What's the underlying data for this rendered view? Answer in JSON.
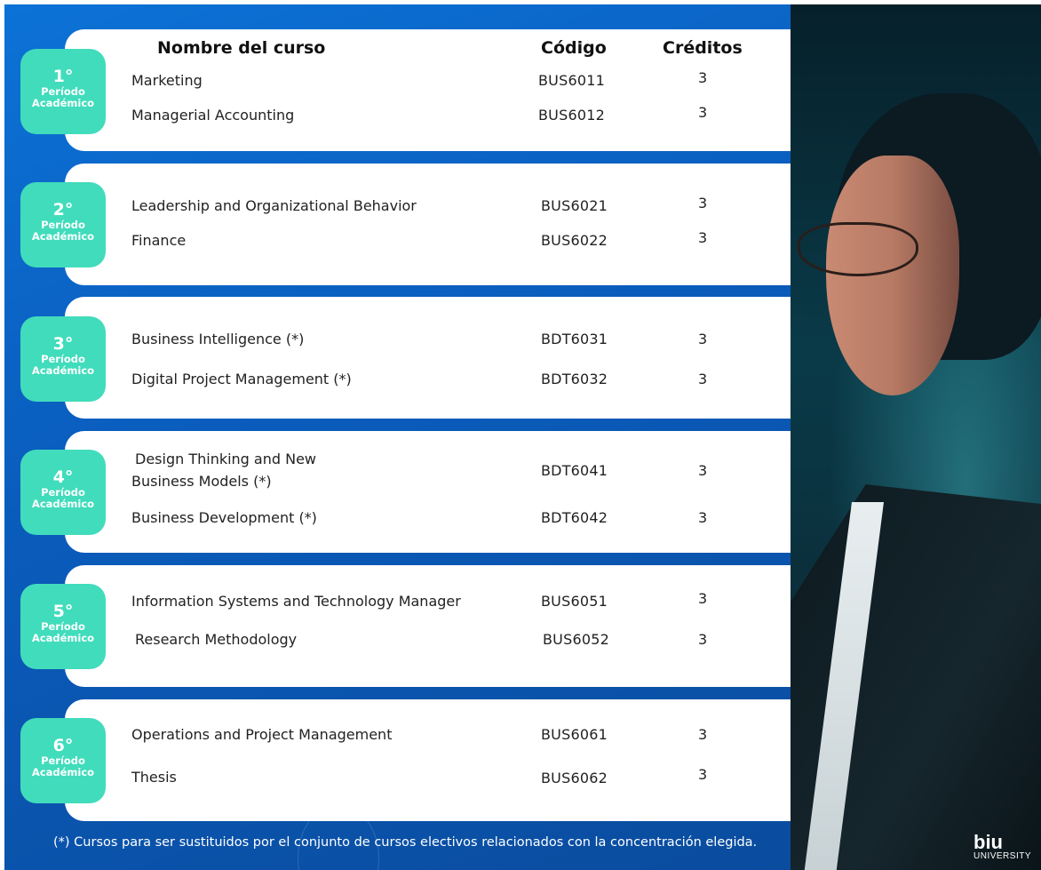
{
  "header": {
    "name_col": "Nombre del curso",
    "code_col": "Código",
    "credits_col": "Créditos"
  },
  "periods": [
    {
      "number": "1°",
      "label_line1": "Período",
      "label_line2": "Académico",
      "courses": [
        {
          "name": "Marketing",
          "code": "BUS6011",
          "credits": "3"
        },
        {
          "name": "Managerial Accounting",
          "code": "BUS6012",
          "credits": "3"
        }
      ]
    },
    {
      "number": "2°",
      "label_line1": "Período",
      "label_line2": "Académico",
      "courses": [
        {
          "name": "Leadership and Organizational Behavior",
          "code": "BUS6021",
          "credits": "3"
        },
        {
          "name": "Finance",
          "code": "BUS6022",
          "credits": "3"
        }
      ]
    },
    {
      "number": "3°",
      "label_line1": "Período",
      "label_line2": "Académico",
      "courses": [
        {
          "name": "Business Intelligence (*)",
          "code": "BDT6031",
          "credits": "3"
        },
        {
          "name": "Digital Project Management (*)",
          "code": "BDT6032",
          "credits": "3"
        }
      ]
    },
    {
      "number": "4°",
      "label_line1": "Período",
      "label_line2": "Académico",
      "courses": [
        {
          "name_line1": "Design Thinking and New",
          "name_line2": "Business Models (*)",
          "code": "BDT6041",
          "credits": "3"
        },
        {
          "name": "Business Development (*)",
          "code": "BDT6042",
          "credits": "3"
        }
      ]
    },
    {
      "number": "5°",
      "label_line1": "Período",
      "label_line2": "Académico",
      "courses": [
        {
          "name": "Information Systems and Technology Manager",
          "code": "BUS6051",
          "credits": "3"
        },
        {
          "name": "Research Methodology",
          "code": "BUS6052",
          "credits": "3"
        }
      ]
    },
    {
      "number": "6°",
      "label_line1": "Período",
      "label_line2": "Académico",
      "courses": [
        {
          "name": "Operations and Project Management",
          "code": "BUS6061",
          "credits": "3"
        },
        {
          "name": "Thesis",
          "code": "BUS6062",
          "credits": "3"
        }
      ]
    }
  ],
  "footnote": "(*) Cursos para ser sustituidos por el conjunto de cursos electivos relacionados con la concentración elegida.",
  "logo": {
    "main": "biu",
    "sub": "UNIVERSITY"
  },
  "colors": {
    "background": "#0a5cbc",
    "badge": "#41dcbc",
    "card": "#ffffff"
  }
}
